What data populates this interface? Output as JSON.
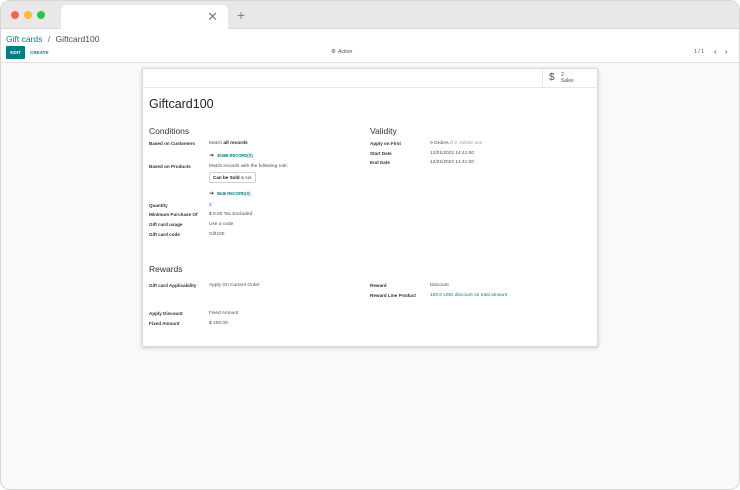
{
  "browser": {
    "tab_title": ""
  },
  "breadcrumb": {
    "parent": "Gift cards",
    "separator": "/",
    "current": "Giftcard100"
  },
  "toolbar": {
    "edit_label": "EDIT",
    "create_label": "CREATE",
    "action_label": "Action",
    "pager": "1 / 1"
  },
  "smart_button": {
    "value": "2",
    "label": "Sales"
  },
  "record": {
    "name": "Giftcard100"
  },
  "conditions": {
    "heading": "Conditions",
    "customers_label": "Based on Customers",
    "customers_prefix": "Match ",
    "customers_bold": "all records",
    "customers_records": "30558 RECORD(S)",
    "products_label": "Based on Products",
    "products_text": "Match records with the following rule:",
    "rule_field": "Can be Sold",
    "rule_op": " is set",
    "products_records": "5646 RECORD(S)",
    "quantity_label": "Quantity",
    "quantity_value": "2",
    "min_purchase_label": "Minimum Purchase Of",
    "min_purchase_value": "$ 0.00  Tax Excluded",
    "usage_label": "Gift card usage",
    "usage_value": "Use a code",
    "code_label": "Gift card code",
    "code_value": "Gift100"
  },
  "validity": {
    "heading": "Validity",
    "apply_first_label": "Apply on First",
    "apply_first_value": "0 Orders ",
    "apply_first_hint": "If 0, infinite use",
    "start_label": "Start Date",
    "start_value": "12/01/2022 14:41:00",
    "end_label": "End Date",
    "end_value": "12/31/2022 14:41:00"
  },
  "rewards": {
    "heading": "Rewards",
    "applicability_label": "Gift card Applicability",
    "applicability_value": "Apply On Current Order",
    "reward_label": "Reward",
    "reward_value": "Discount",
    "line_product_label": "Reward Line Product",
    "line_product_value": "100.0 USD discount on total amount",
    "apply_discount_label": "Apply Discount",
    "apply_discount_value": "Fixed Amount",
    "fixed_amount_label": "Fixed Amount",
    "fixed_amount_value": "$ 100.00"
  },
  "colors": {
    "accent": "#017e84",
    "close_dot": "#fe5f57",
    "minimize_dot": "#febc2e",
    "zoom_dot": "#28c840"
  }
}
